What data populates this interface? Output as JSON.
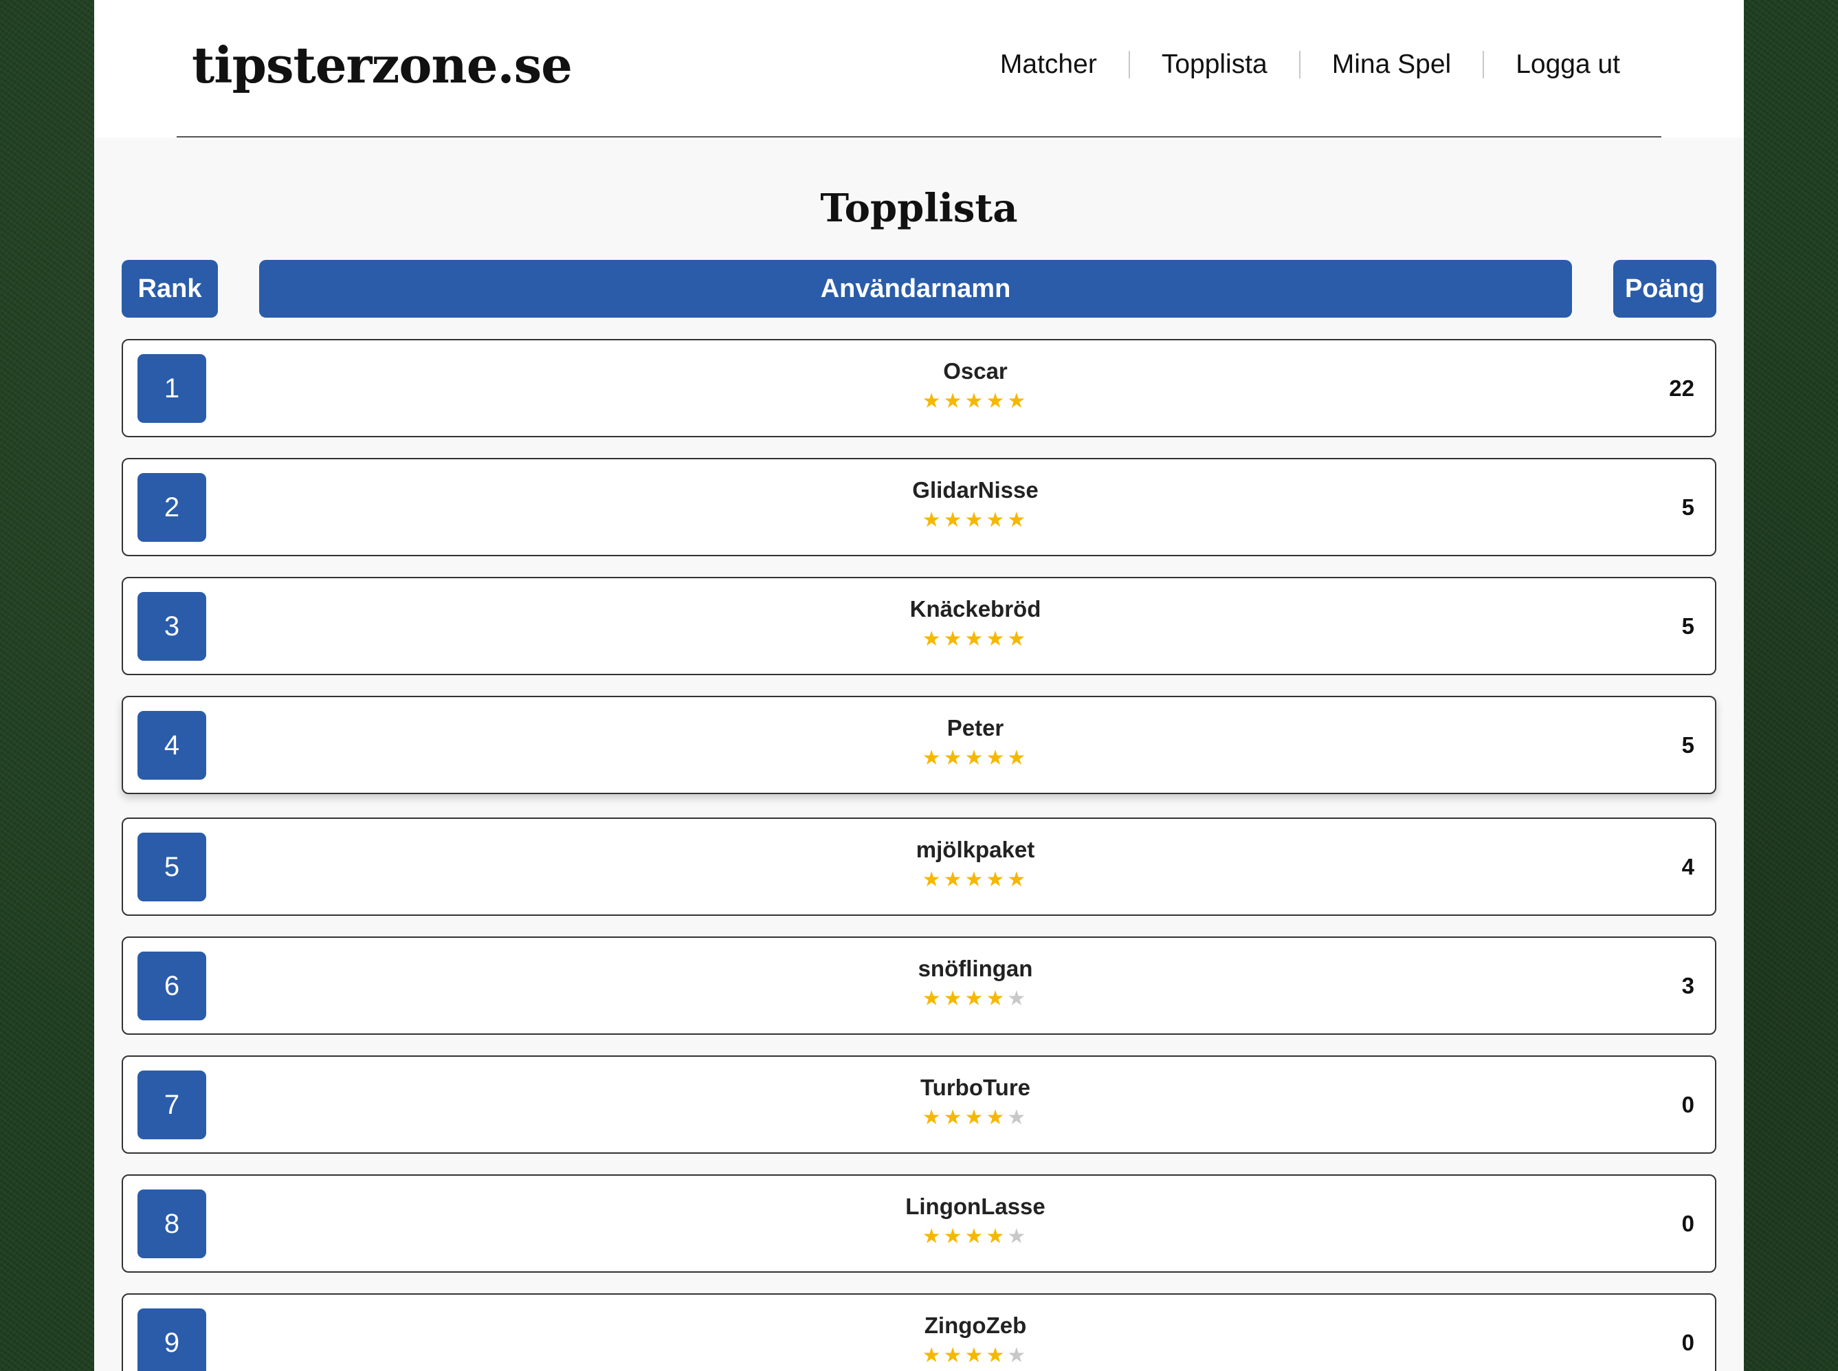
{
  "header": {
    "logo": "tipsterzone.se",
    "nav": [
      {
        "label": "Matcher",
        "name": "nav-matcher"
      },
      {
        "label": "Topplista",
        "name": "nav-topplista"
      },
      {
        "label": "Mina Spel",
        "name": "nav-mina-spel"
      },
      {
        "label": "Logga ut",
        "name": "nav-logga-ut"
      }
    ]
  },
  "main": {
    "title": "Topplista",
    "columns": {
      "rank": "Rank",
      "username": "Användarnamn",
      "points": "Poäng"
    },
    "rows": [
      {
        "rank": "1",
        "name": "Oscar",
        "points": "22",
        "stars": 5
      },
      {
        "rank": "2",
        "name": "GlidarNisse",
        "points": "5",
        "stars": 5
      },
      {
        "rank": "3",
        "name": "Knäckebröd",
        "points": "5",
        "stars": 5
      },
      {
        "rank": "4",
        "name": "Peter",
        "points": "5",
        "stars": 5
      },
      {
        "rank": "5",
        "name": "mjölkpaket",
        "points": "4",
        "stars": 5
      },
      {
        "rank": "6",
        "name": "snöflingan",
        "points": "3",
        "stars": 4
      },
      {
        "rank": "7",
        "name": "TurboTure",
        "points": "0",
        "stars": 4
      },
      {
        "rank": "8",
        "name": "LingonLasse",
        "points": "0",
        "stars": 4
      },
      {
        "rank": "9",
        "name": "ZingoZeb",
        "points": "0",
        "stars": 4
      }
    ],
    "highlighted_rank": "4",
    "max_stars": 5
  },
  "colors": {
    "accent": "#2a5caa",
    "star_on": "#f5b800",
    "star_off": "#c8c8c8",
    "background": "#1e3d1f"
  }
}
